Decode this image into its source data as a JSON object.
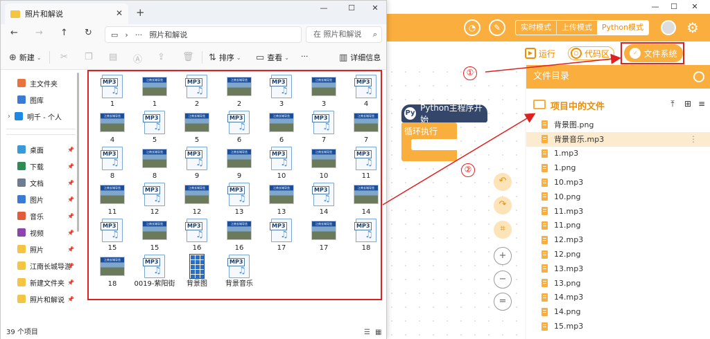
{
  "explorer": {
    "tab_title": "照片和解说",
    "tab_close": "✕",
    "new_tab": "+",
    "window_controls": {
      "minimize": "—",
      "maximize": "☐",
      "close": "✕"
    },
    "nav_buttons": {
      "back": "←",
      "forward": "→",
      "up": "↑",
      "refresh": "↻"
    },
    "address": {
      "ellipsis": "···",
      "chevron": "›",
      "path": "照片和解说"
    },
    "search_placeholder": "在 照片和解说",
    "search_icon": "search-icon",
    "commands": {
      "new": "新建",
      "sort": "排序",
      "view": "查看",
      "more": "···",
      "details": "详细信息"
    },
    "nav_pane": [
      {
        "label": "主文件夹",
        "icon": "home-icon",
        "color": "#e8743b"
      },
      {
        "label": "图库",
        "icon": "gallery-icon",
        "color": "#3a7bd5"
      },
      {
        "label": "明千 - 个人",
        "icon": "cloud-icon",
        "color": "#1e88e5"
      },
      {
        "label": "桌面",
        "icon": "desktop-icon",
        "color": "#3a9ad9"
      },
      {
        "label": "下载",
        "icon": "download-icon",
        "color": "#2e8b57"
      },
      {
        "label": "文档",
        "icon": "document-icon",
        "color": "#6b7c93"
      },
      {
        "label": "图片",
        "icon": "picture-icon",
        "color": "#3a7bd5"
      },
      {
        "label": "音乐",
        "icon": "music-icon",
        "color": "#e25b3b"
      },
      {
        "label": "视频",
        "icon": "video-icon",
        "color": "#8e44ad"
      },
      {
        "label": "照片",
        "icon": "folder-icon",
        "color": "#f4c542"
      },
      {
        "label": "江南长城导游",
        "icon": "folder-icon",
        "color": "#f4c542"
      },
      {
        "label": "新建文件夹",
        "icon": "folder-icon",
        "color": "#f4c542"
      },
      {
        "label": "照片和解说",
        "icon": "folder-icon",
        "color": "#f4c542"
      }
    ],
    "files": [
      {
        "name": "1",
        "type": "mp3"
      },
      {
        "name": "1",
        "type": "png"
      },
      {
        "name": "2",
        "type": "mp3"
      },
      {
        "name": "2",
        "type": "png"
      },
      {
        "name": "3",
        "type": "mp3"
      },
      {
        "name": "3",
        "type": "png"
      },
      {
        "name": "4",
        "type": "mp3"
      },
      {
        "name": "4",
        "type": "png"
      },
      {
        "name": "5",
        "type": "mp3"
      },
      {
        "name": "5",
        "type": "png"
      },
      {
        "name": "6",
        "type": "mp3"
      },
      {
        "name": "6",
        "type": "png"
      },
      {
        "name": "7",
        "type": "mp3"
      },
      {
        "name": "7",
        "type": "png"
      },
      {
        "name": "8",
        "type": "mp3"
      },
      {
        "name": "8",
        "type": "png"
      },
      {
        "name": "9",
        "type": "mp3"
      },
      {
        "name": "9",
        "type": "png"
      },
      {
        "name": "10",
        "type": "mp3"
      },
      {
        "name": "10",
        "type": "png"
      },
      {
        "name": "11",
        "type": "mp3"
      },
      {
        "name": "11",
        "type": "png"
      },
      {
        "name": "12",
        "type": "mp3"
      },
      {
        "name": "12",
        "type": "png"
      },
      {
        "name": "13",
        "type": "mp3"
      },
      {
        "name": "13",
        "type": "png"
      },
      {
        "name": "14",
        "type": "mp3"
      },
      {
        "name": "14",
        "type": "png"
      },
      {
        "name": "15",
        "type": "mp3"
      },
      {
        "name": "15",
        "type": "png"
      },
      {
        "name": "16",
        "type": "mp3"
      },
      {
        "name": "16",
        "type": "png"
      },
      {
        "name": "17",
        "type": "mp3"
      },
      {
        "name": "17",
        "type": "png"
      },
      {
        "name": "18",
        "type": "mp3"
      },
      {
        "name": "18",
        "type": "png"
      },
      {
        "name": "0019-紫阳街",
        "type": "mp3"
      },
      {
        "name": "背景图",
        "type": "grid"
      },
      {
        "name": "背景音乐",
        "type": "mp3"
      }
    ],
    "mp3_tag": "MP3",
    "note_glyph": "♫",
    "thumb_strip": "江南长城导览",
    "status": "39 个项目"
  },
  "app": {
    "window_controls": {
      "minimize": "—",
      "maximize": "☐",
      "close": "✕"
    },
    "modes": [
      "实时模式",
      "上传模式",
      "Python模式"
    ],
    "active_mode": "Python模式",
    "toolbar": {
      "run": "运行",
      "code": "代码区",
      "filesystem": "文件系统"
    },
    "blocks": {
      "hat": "Python主程序开始",
      "loop": "循环执行",
      "py_glyph": "Py"
    },
    "controls": {
      "undo": "↶",
      "redo": "↷",
      "crop": "⌗",
      "zoom_in": "+",
      "zoom_out": "−",
      "reset": "="
    },
    "files_panel": {
      "header": "文件目录",
      "project_title": "项目中的文件",
      "actions": {
        "upload": "⤒",
        "new": "⊞",
        "menu": "≡"
      },
      "more_glyph": "⋮",
      "selected": "背景音乐.mp3",
      "files": [
        "背景图.png",
        "背景音乐.mp3",
        "1.mp3",
        "1.png",
        "10.mp3",
        "10.png",
        "11.mp3",
        "11.png",
        "12.mp3",
        "12.png",
        "13.mp3",
        "13.png",
        "14.mp3",
        "14.png",
        "15.mp3"
      ]
    }
  },
  "annotations": {
    "badge1": "①",
    "badge2": "②",
    "color": "#e02020"
  }
}
